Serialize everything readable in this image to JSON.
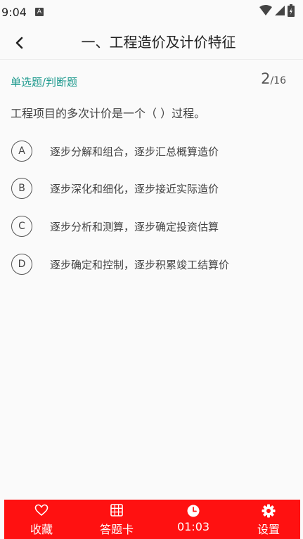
{
  "status": {
    "time": "9:04",
    "a_icon": "A"
  },
  "header": {
    "title": "一、工程造价及计价特征"
  },
  "question": {
    "type_label": "单选题/判断题",
    "current": "2",
    "total": "/16",
    "text": "工程项目的多次计价是一个（   ）过程。",
    "options": [
      {
        "letter": "A",
        "text": "逐步分解和组合，逐步汇总概算造价"
      },
      {
        "letter": "B",
        "text": "逐步深化和细化，逐步接近实际造价"
      },
      {
        "letter": "C",
        "text": "逐步分析和测算，逐步确定投资估算"
      },
      {
        "letter": "D",
        "text": "逐步确定和控制，逐步积累竣工结算价"
      }
    ]
  },
  "bottom_nav": {
    "favorite": {
      "label": "收藏",
      "icon": "heart-icon"
    },
    "answer_card": {
      "label": "答题卡",
      "icon": "grid-icon"
    },
    "timer": {
      "label": "01:03",
      "icon": "clock-icon"
    },
    "settings": {
      "label": "设置",
      "icon": "gear-icon"
    }
  },
  "colors": {
    "accent": "#ff1111",
    "type_label": "#1f9a8e"
  }
}
